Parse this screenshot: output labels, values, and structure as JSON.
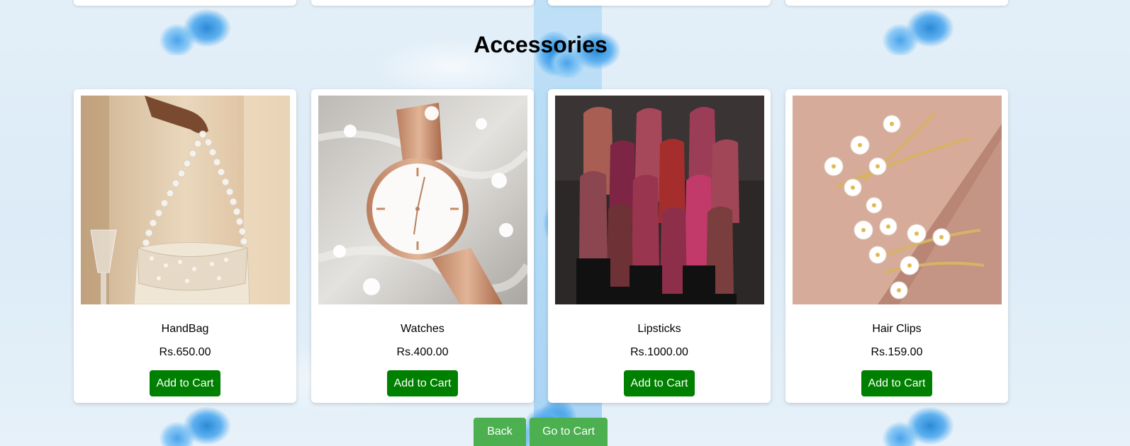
{
  "section": {
    "title": "Accessories"
  },
  "products": [
    {
      "name": "HandBag",
      "price": "Rs.650.00",
      "button_label": "Add to Cart",
      "image_icon": "pearl-handbag-image"
    },
    {
      "name": "Watches",
      "price": "Rs.400.00",
      "button_label": "Add to Cart",
      "image_icon": "rose-gold-watch-image"
    },
    {
      "name": "Lipsticks",
      "price": "Rs.1000.00",
      "button_label": "Add to Cart",
      "image_icon": "lipsticks-image"
    },
    {
      "name": "Hair Clips",
      "price": "Rs.159.00",
      "button_label": "Add to Cart",
      "image_icon": "flower-hair-clips-image"
    }
  ],
  "nav": {
    "back_label": "Back",
    "cart_label": "Go to Cart"
  },
  "colors": {
    "add_button": "#008000",
    "nav_button": "#4caf50",
    "card": "#ffffff"
  }
}
